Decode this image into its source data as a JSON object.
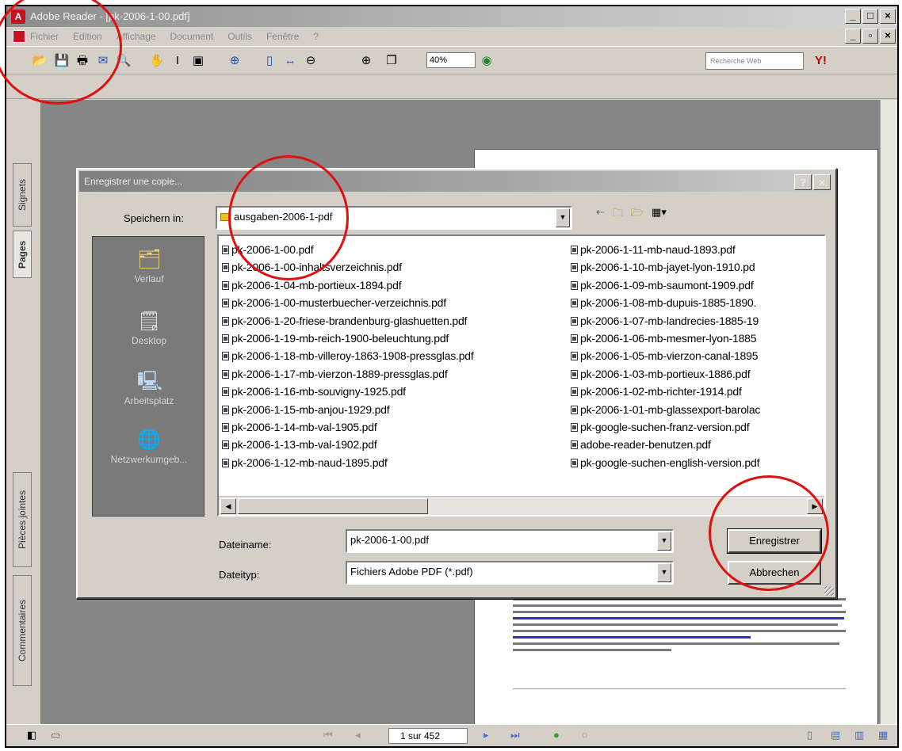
{
  "app": {
    "title": "Adobe Reader - [pk-2006-1-00.pdf]",
    "menu": [
      "Fichier",
      "Edition",
      "Affichage",
      "Document",
      "Outils",
      "Fenêtre",
      "?"
    ],
    "zoom": "40%",
    "search_placeholder": "Recherche Web",
    "page_indicator": "1 sur 452"
  },
  "sidepanel": {
    "tabs": [
      "Signets",
      "Pages",
      "Pièces jointes",
      "Commentaires"
    ]
  },
  "dialog": {
    "title": "Enregistrer une copie...",
    "save_in_label": "Speichern in:",
    "save_in_value": "ausgaben-2006-1-pdf",
    "places": [
      "Verlauf",
      "Desktop",
      "Arbeitsplatz",
      "Netzwerkumgeb..."
    ],
    "files_col1": [
      "pk-2006-1-00.pdf",
      "pk-2006-1-00-inhaltsverzeichnis.pdf",
      "pk-2006-1-04-mb-portieux-1894.pdf",
      "pk-2006-1-00-musterbuecher-verzeichnis.pdf",
      "pk-2006-1-20-friese-brandenburg-glashuetten.pdf",
      "pk-2006-1-19-mb-reich-1900-beleuchtung.pdf",
      "pk-2006-1-18-mb-villeroy-1863-1908-pressglas.pdf",
      "pk-2006-1-17-mb-vierzon-1889-pressglas.pdf",
      "pk-2006-1-16-mb-souvigny-1925.pdf",
      "pk-2006-1-15-mb-anjou-1929.pdf",
      "pk-2006-1-14-mb-val-1905.pdf",
      "pk-2006-1-13-mb-val-1902.pdf",
      "pk-2006-1-12-mb-naud-1895.pdf"
    ],
    "files_col2": [
      "pk-2006-1-11-mb-naud-1893.pdf",
      "pk-2006-1-10-mb-jayet-lyon-1910.pd",
      "pk-2006-1-09-mb-saumont-1909.pdf",
      "pk-2006-1-08-mb-dupuis-1885-1890.",
      "pk-2006-1-07-mb-landrecies-1885-19",
      "pk-2006-1-06-mb-mesmer-lyon-1885",
      "pk-2006-1-05-mb-vierzon-canal-1895",
      "pk-2006-1-03-mb-portieux-1886.pdf",
      "pk-2006-1-02-mb-richter-1914.pdf",
      "pk-2006-1-01-mb-glassexport-barolac",
      "pk-google-suchen-franz-version.pdf",
      "adobe-reader-benutzen.pdf",
      "pk-google-suchen-english-version.pdf"
    ],
    "filename_label": "Dateiname:",
    "filename_value": "pk-2006-1-00.pdf",
    "filetype_label": "Dateityp:",
    "filetype_value": "Fichiers Adobe PDF (*.pdf)",
    "save_button": "Enregistrer",
    "cancel_button": "Abbrechen",
    "help_button": "?",
    "close_button": "×"
  },
  "colors": {
    "annotation_circle": "#e01010",
    "acrobat_red": "#c8101e"
  }
}
